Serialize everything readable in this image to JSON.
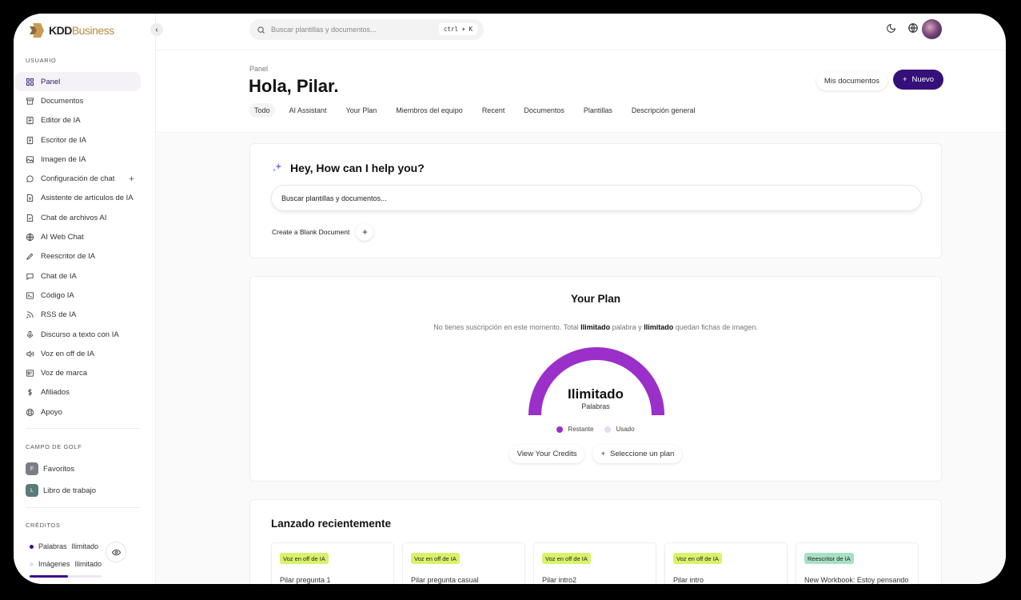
{
  "brand": {
    "name_kdd": "KDD",
    "name_business": "Business"
  },
  "search": {
    "placeholder": "Buscar plantillas y documentos...",
    "shortcut": "ctrl + K"
  },
  "sidebar": {
    "user_label": "USUARIO",
    "items": [
      {
        "label": "Panel",
        "icon": "grid-icon"
      },
      {
        "label": "Documentos",
        "icon": "archive-icon"
      },
      {
        "label": "Editor de IA",
        "icon": "editor-icon"
      },
      {
        "label": "Escritor de IA",
        "icon": "document-icon"
      },
      {
        "label": "Imagen de IA",
        "icon": "image-icon"
      },
      {
        "label": "Configuración de chat",
        "icon": "chat-icon"
      },
      {
        "label": "Asistente de artículos de IA",
        "icon": "article-icon"
      },
      {
        "label": "Chat de archivos AI",
        "icon": "file-chat-icon"
      },
      {
        "label": "AI Web Chat",
        "icon": "globe-icon"
      },
      {
        "label": "Reescritor de IA",
        "icon": "pencil-icon"
      },
      {
        "label": "Chat de IA",
        "icon": "message-icon"
      },
      {
        "label": "Código IA",
        "icon": "terminal-icon"
      },
      {
        "label": "RSS de IA",
        "icon": "rss-icon"
      },
      {
        "label": "Discurso a texto con IA",
        "icon": "microphone-icon"
      },
      {
        "label": "Voz en off de IA",
        "icon": "speaker-icon"
      },
      {
        "label": "Voz de marca",
        "icon": "brand-icon"
      },
      {
        "label": "Afiliados",
        "icon": "dollar-icon"
      },
      {
        "label": "Apoyo",
        "icon": "lifebuoy-icon"
      }
    ],
    "workspace_label": "CAMPO DE GOLF",
    "workspace": [
      {
        "badge": "F",
        "label": "Favoritos",
        "color": "#7a7f86"
      },
      {
        "badge": "L",
        "label": "Libro de trabajo",
        "color": "#5b7b79"
      }
    ],
    "credits_label": "CRÉDITOS",
    "credits": [
      {
        "label": "Palabras",
        "value": "Ilimitado",
        "color": "#3b0b8c"
      },
      {
        "label": "Imágenes",
        "value": "Ilimitado",
        "color": "#e8dcf7"
      }
    ]
  },
  "header": {
    "breadcrumb": "Panel",
    "title": "Hola, Pilar.",
    "my_docs": "Mis documentos",
    "new_button": "Nuevo",
    "tabs": [
      "Todo",
      "AI Assistant",
      "Your Plan",
      "Miembros del equipo",
      "Recent",
      "Documentos",
      "Plantillas",
      "Descripción general"
    ]
  },
  "assistant": {
    "title": "Hey, How can I help you?",
    "input_placeholder": "Buscar plantillas y documentos...",
    "blank_doc": "Create a Blank Document"
  },
  "plan": {
    "title": "Your Plan",
    "desc_pre": "No tienes suscripción en este momento. Total ",
    "desc_b1": "Ilimitado",
    "desc_mid": " palabra y ",
    "desc_b2": "Ilimitado",
    "desc_post": " quedan fichas de imagen.",
    "gauge_value": "Ilimitado",
    "gauge_unit": "Palabras",
    "remaining_fraction": 1.0,
    "legend_remaining": "Restante",
    "legend_used": "Usado",
    "remaining_color": "#9b2fc9",
    "used_color": "#ead9f5",
    "btn_credits": "View Your Credits",
    "btn_plan": "Seleccione un plan"
  },
  "recent": {
    "title": "Lanzado recientemente",
    "items": [
      {
        "tag": "Voz en off de IA",
        "title": "Pilar pregunta 1",
        "tag_color": "#d9f26b"
      },
      {
        "tag": "Voz en off de IA",
        "title": "Pilar pregunta casual",
        "tag_color": "#d9f26b"
      },
      {
        "tag": "Voz en off de IA",
        "title": "Pilar intro2",
        "tag_color": "#d9f26b"
      },
      {
        "tag": "Voz en off de IA",
        "title": "Pilar intro",
        "tag_color": "#d9f26b"
      },
      {
        "tag": "Reescritor de IA",
        "title": "New Workbook: Estoy pensando",
        "tag_color": "#a8e0c4"
      }
    ]
  }
}
